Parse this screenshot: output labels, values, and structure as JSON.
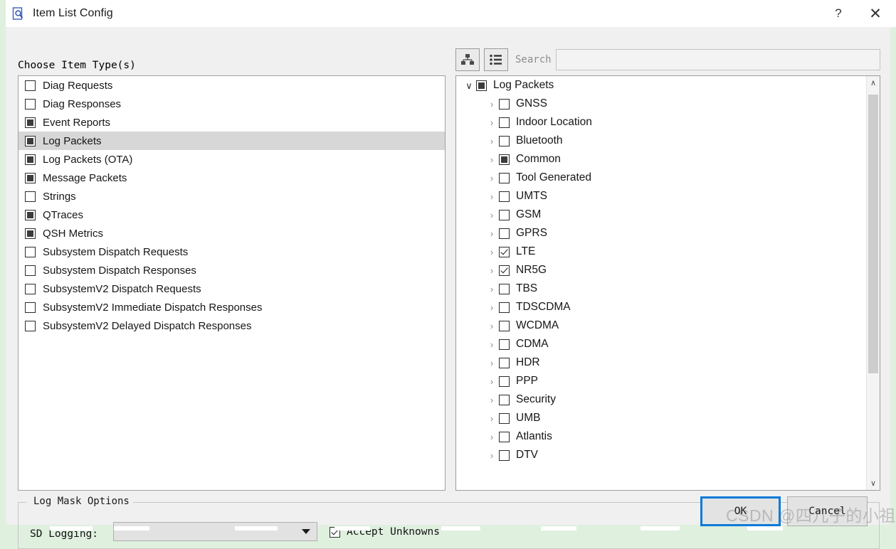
{
  "window": {
    "title": "Item List Config",
    "icon": "document-search-icon",
    "help_label": "?",
    "close_label": "✕"
  },
  "left_panel": {
    "title": "Choose Item Type(s)",
    "items": [
      {
        "label": "Diag Requests",
        "state": "unchecked",
        "selected": false
      },
      {
        "label": "Diag Responses",
        "state": "unchecked",
        "selected": false
      },
      {
        "label": "Event Reports",
        "state": "partial",
        "selected": false
      },
      {
        "label": "Log Packets",
        "state": "partial",
        "selected": true
      },
      {
        "label": "Log Packets (OTA)",
        "state": "partial",
        "selected": false
      },
      {
        "label": "Message Packets",
        "state": "partial",
        "selected": false
      },
      {
        "label": "Strings",
        "state": "unchecked",
        "selected": false
      },
      {
        "label": "QTraces",
        "state": "partial",
        "selected": false
      },
      {
        "label": "QSH Metrics",
        "state": "partial",
        "selected": false
      },
      {
        "label": "Subsystem Dispatch Requests",
        "state": "unchecked",
        "selected": false
      },
      {
        "label": "Subsystem Dispatch Responses",
        "state": "unchecked",
        "selected": false
      },
      {
        "label": "SubsystemV2 Dispatch Requests",
        "state": "unchecked",
        "selected": false
      },
      {
        "label": "SubsystemV2 Immediate Dispatch Responses",
        "state": "unchecked",
        "selected": false
      },
      {
        "label": "SubsystemV2 Delayed Dispatch Responses",
        "state": "unchecked",
        "selected": false
      }
    ]
  },
  "right_panel": {
    "toolbar": {
      "tree_view_icon": "hierarchy-icon",
      "list_view_icon": "list-icon",
      "search_label": "Search",
      "search_value": "",
      "search_placeholder": ""
    },
    "tree": [
      {
        "label": "Log Packets",
        "state": "partial",
        "level": 0,
        "expanded": true
      },
      {
        "label": "GNSS",
        "state": "unchecked",
        "level": 1,
        "expanded": false
      },
      {
        "label": "Indoor Location",
        "state": "unchecked",
        "level": 1,
        "expanded": false
      },
      {
        "label": "Bluetooth",
        "state": "unchecked",
        "level": 1,
        "expanded": false
      },
      {
        "label": "Common",
        "state": "partial",
        "level": 1,
        "expanded": false
      },
      {
        "label": "Tool Generated",
        "state": "unchecked",
        "level": 1,
        "expanded": false
      },
      {
        "label": "UMTS",
        "state": "unchecked",
        "level": 1,
        "expanded": false
      },
      {
        "label": "GSM",
        "state": "unchecked",
        "level": 1,
        "expanded": false
      },
      {
        "label": "GPRS",
        "state": "unchecked",
        "level": 1,
        "expanded": false
      },
      {
        "label": "LTE",
        "state": "checked",
        "level": 1,
        "expanded": false
      },
      {
        "label": "NR5G",
        "state": "checked",
        "level": 1,
        "expanded": false
      },
      {
        "label": "TBS",
        "state": "unchecked",
        "level": 1,
        "expanded": false
      },
      {
        "label": "TDSCDMA",
        "state": "unchecked",
        "level": 1,
        "expanded": false
      },
      {
        "label": "WCDMA",
        "state": "unchecked",
        "level": 1,
        "expanded": false
      },
      {
        "label": "CDMA",
        "state": "unchecked",
        "level": 1,
        "expanded": false
      },
      {
        "label": "HDR",
        "state": "unchecked",
        "level": 1,
        "expanded": false
      },
      {
        "label": "PPP",
        "state": "unchecked",
        "level": 1,
        "expanded": false
      },
      {
        "label": "Security",
        "state": "unchecked",
        "level": 1,
        "expanded": false
      },
      {
        "label": "UMB",
        "state": "unchecked",
        "level": 1,
        "expanded": false
      },
      {
        "label": "Atlantis",
        "state": "unchecked",
        "level": 1,
        "expanded": false
      },
      {
        "label": "DTV",
        "state": "unchecked",
        "level": 1,
        "expanded": false
      }
    ],
    "scrollbar": {
      "up_glyph": "∧",
      "down_glyph": "∨"
    }
  },
  "log_mask_options": {
    "title": "Log Mask Options",
    "sd_logging_label": "SD Logging:",
    "sd_logging_value": "",
    "accept_unknowns_label": "Accept Unknowns",
    "accept_unknowns_state": "checked"
  },
  "footer": {
    "ok_label": "OK",
    "cancel_label": "Cancel"
  },
  "watermark": {
    "text": "CSDN @四儿子的小祖宗"
  }
}
